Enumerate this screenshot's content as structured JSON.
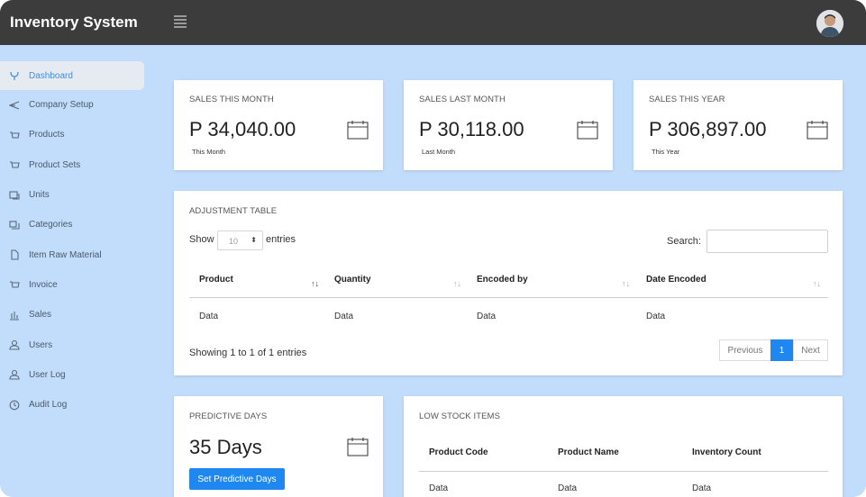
{
  "app": {
    "title": "Inventory System"
  },
  "sidebar": {
    "items": [
      {
        "label": "Dashboard",
        "icon": "dashboard-icon",
        "active": true
      },
      {
        "label": "Company Setup",
        "icon": "send-icon"
      },
      {
        "label": "Products",
        "icon": "cart-icon"
      },
      {
        "label": "Product Sets",
        "icon": "cart-icon"
      },
      {
        "label": "Units",
        "icon": "units-icon"
      },
      {
        "label": "Categories",
        "icon": "categories-icon"
      },
      {
        "label": "Item Raw Material",
        "icon": "file-icon"
      },
      {
        "label": "Invoice",
        "icon": "cart-icon"
      },
      {
        "label": "Sales",
        "icon": "bar-chart-icon"
      },
      {
        "label": "Users",
        "icon": "user-icon"
      },
      {
        "label": "User Log",
        "icon": "user-icon"
      },
      {
        "label": "Audit Log",
        "icon": "clock-icon"
      }
    ]
  },
  "stats": [
    {
      "title": "SALES THIS MONTH",
      "value": "P 34,040.00",
      "caption": "This Month"
    },
    {
      "title": "SALES LAST MONTH",
      "value": "P 30,118.00",
      "caption": "Last Month"
    },
    {
      "title": "SALES THIS YEAR",
      "value": "P 306,897.00",
      "caption": "This Year"
    }
  ],
  "adjustment": {
    "title": "ADJUSTMENT TABLE",
    "show_label": "Show",
    "entries_value": "10",
    "entries_label": "entries",
    "search_label": "Search:",
    "search_value": "",
    "columns": [
      "Product",
      "Quantity",
      "Encoded by",
      "Date Encoded"
    ],
    "rows": [
      [
        "Data",
        "Data",
        "Data",
        "Data"
      ]
    ],
    "info": "Showing 1 to 1 of 1 entries",
    "prev_label": "Previous",
    "page_label": "1",
    "next_label": "Next"
  },
  "predictive": {
    "title": "PREDICTIVE DAYS",
    "value": "35 Days",
    "button_label": "Set Predictive Days"
  },
  "low_stock": {
    "title": "LOW STOCK ITEMS",
    "columns": [
      "Product Code",
      "Product Name",
      "Inventory Count"
    ],
    "rows": [
      [
        "Data",
        "Data",
        "Data"
      ]
    ]
  },
  "colors": {
    "topbar": "#3c3c3c",
    "background": "#c2dcfb",
    "accent": "#1e88f0"
  }
}
